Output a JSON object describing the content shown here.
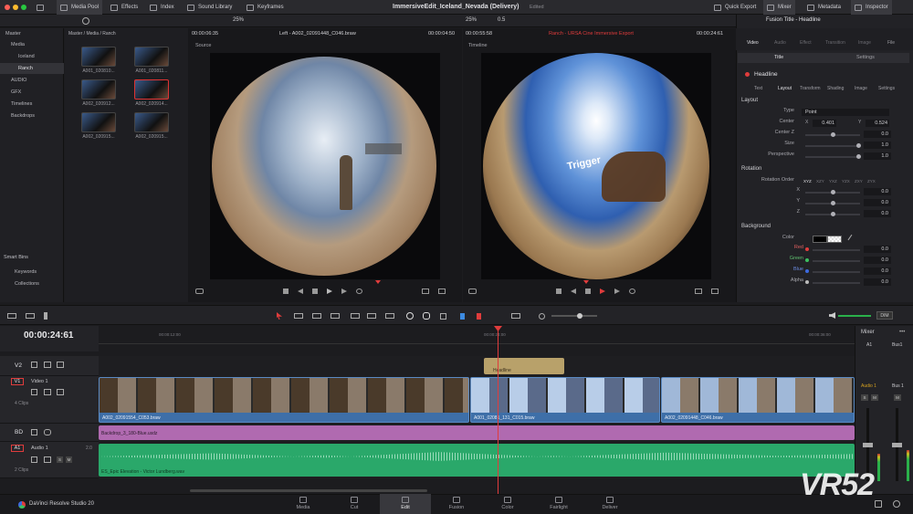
{
  "titlebar": {
    "project_title": "ImmersiveEdit_Iceland_Nevada (Delivery)",
    "status": "Edited",
    "left_buttons": [
      "Media Pool",
      "Effects",
      "Index",
      "Sound Library",
      "Keyframes"
    ],
    "right_buttons": [
      "Quick Export",
      "Mixer",
      "Metadata",
      "Inspector"
    ],
    "zoom_left": "25%",
    "zoom_right": "25%",
    "speed": "0.5"
  },
  "media_pool": {
    "bins": [
      "Master",
      "Media",
      "Iceland",
      "Ranch",
      "AUDIO",
      "GFX",
      "Timelines",
      "Backdrops"
    ],
    "selected_bin": "Ranch",
    "breadcrumb": "Master / Media / Ranch",
    "smart_bins_title": "Smart Bins",
    "smart_bins": [
      "Keywords",
      "Collections"
    ],
    "clips": [
      "A001_020810...",
      "A001_020811...",
      "A002_020912...",
      "A002_020914...",
      "A002_020915...",
      "A002_020915..."
    ]
  },
  "source_viewer": {
    "timecode": "00:00:06:35",
    "source_label": "Source",
    "clip_name": "Left - A002_02091448_C046.braw",
    "duration": "00:00:04:50"
  },
  "timeline_viewer": {
    "timecode": "00:00:55:58",
    "timeline_label": "Timeline",
    "name": "Ranch - URSA Cine Immersive Export",
    "tc_right": "00:00:24:61",
    "overlay_text": "Trigger"
  },
  "inspector": {
    "title": "Fusion Title - Headline",
    "tabs": [
      "Video",
      "Audio",
      "Effect",
      "Transition",
      "Image",
      "File"
    ],
    "subtabs": [
      "Title",
      "Settings"
    ],
    "node_name": "Headline",
    "node_tabs": [
      "Text",
      "Layout",
      "Transform",
      "Shading",
      "Image",
      "Settings"
    ],
    "active_node_tab": "Layout",
    "layout": {
      "section": "Layout",
      "type_label": "Type",
      "type_value": "Point",
      "center_label": "Center",
      "center_x": "0.401",
      "center_y": "0.524",
      "center_z_label": "Center Z",
      "center_z": "0.0",
      "size_label": "Size",
      "size": "1.0",
      "perspective_label": "Perspective",
      "perspective": "1.0"
    },
    "rotation": {
      "section": "Rotation",
      "order_label": "Rotation Order",
      "orders": [
        "XYZ",
        "XZY",
        "YXZ",
        "YZX",
        "ZXY",
        "ZYX"
      ],
      "x": "0.0",
      "y": "0.0",
      "z": "0.0"
    },
    "background": {
      "section": "Background",
      "color_label": "Color",
      "red": "0.0",
      "green": "0.0",
      "blue": "0.0",
      "alpha": "0.0"
    }
  },
  "timeline": {
    "timecode": "00:00:24:61",
    "ruler": [
      "00:00:12:00",
      "00:00:24:00",
      "00:00:36:00"
    ],
    "tracks": [
      {
        "id": "V2",
        "name": ""
      },
      {
        "id": "V1",
        "name": "Video 1",
        "clips": "4 Clips"
      },
      {
        "id": "BD",
        "name": ""
      },
      {
        "id": "A1",
        "name": "Audio 1",
        "level": "2.0",
        "clips": "2 Clips"
      }
    ],
    "v2_clip": "Headline",
    "v1_clips": [
      "A002_02091554_C053.braw",
      "A001_02081_131_C015.braw",
      "A002_02091448_C046.braw"
    ],
    "bd_clip": "Backdrop_3_180-Blue.usdz",
    "a1_clip": "ES_Epic Elevation - Victor Lundberg.wav",
    "dim_label": "DIM"
  },
  "mixer": {
    "title": "Mixer",
    "channels": [
      "A1",
      "Bus1"
    ],
    "channel_labels": [
      "Audio 1",
      "Bus 1"
    ]
  },
  "pages": [
    "Media",
    "Cut",
    "Edit",
    "Fusion",
    "Color",
    "Fairlight",
    "Deliver"
  ],
  "active_page": "Edit",
  "app_name": "DaVinci Resolve Studio 20",
  "watermark": "VR52",
  "colors": {
    "accent_red": "#e03c3c",
    "video_clip": "#3e6fa8",
    "audio_clip": "#2aa86a",
    "backdrop_clip": "#b06ab0",
    "title_clip": "#b8a16a"
  }
}
